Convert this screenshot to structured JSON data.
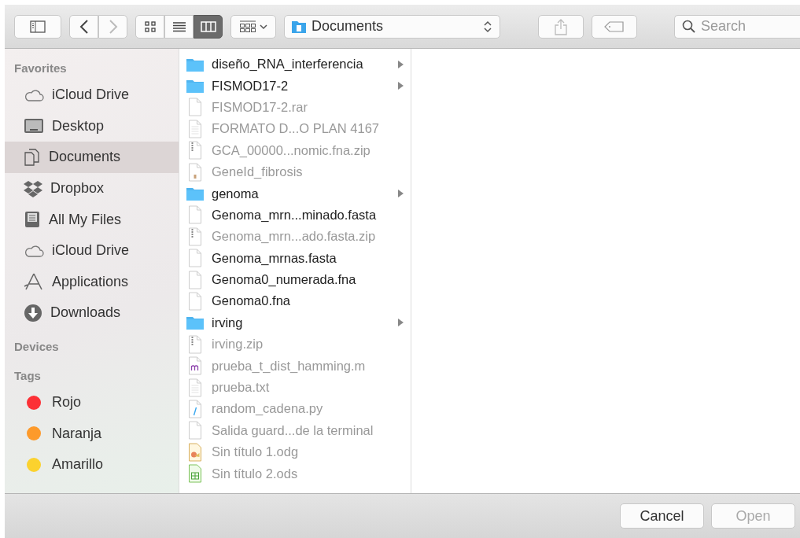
{
  "toolbar": {
    "views": [
      {
        "kind": "icon",
        "selected": false
      },
      {
        "kind": "list",
        "selected": false
      },
      {
        "kind": "column",
        "selected": true
      }
    ],
    "back_disabled": false,
    "forward_disabled": true,
    "share_disabled": true,
    "location": "Documents",
    "search": {
      "placeholder": "Search"
    }
  },
  "sidebar": {
    "sections": [
      {
        "title": "Favorites",
        "items": [
          {
            "label": "iCloud Drive",
            "kind": "cloud",
            "selected": false
          },
          {
            "label": "Desktop",
            "kind": "desktop",
            "selected": false
          },
          {
            "label": "Documents",
            "kind": "documents",
            "selected": true
          },
          {
            "label": "Dropbox",
            "kind": "dropbox",
            "selected": false
          },
          {
            "label": "All My Files",
            "kind": "allfiles",
            "selected": false
          },
          {
            "label": "iCloud Drive",
            "kind": "cloud",
            "selected": false
          },
          {
            "label": "Applications",
            "kind": "apps",
            "selected": false
          },
          {
            "label": "Downloads",
            "kind": "downloads",
            "selected": false
          }
        ]
      },
      {
        "title": "Devices"
      },
      {
        "title": "Tags",
        "items": [
          {
            "label": "Rojo",
            "kind": "tag",
            "color": "#fc3036",
            "selected": false
          },
          {
            "label": "Naranja",
            "kind": "tag",
            "color": "#fd9a2b",
            "selected": false
          },
          {
            "label": "Amarillo",
            "kind": "tag",
            "color": "#fbd22e",
            "selected": false
          }
        ]
      }
    ]
  },
  "column": {
    "items": [
      {
        "name": "diseño_RNA_interferencia",
        "kind": "folder",
        "disabled": false
      },
      {
        "name": "FISMOD17-2",
        "kind": "folder",
        "disabled": false
      },
      {
        "name": "FISMOD17-2.rar",
        "kind": "file",
        "disabled": true
      },
      {
        "name": "FORMATO D...O PLAN 4167",
        "kind": "text",
        "disabled": true
      },
      {
        "name": "GCA_00000...nomic.fna.zip",
        "kind": "zip",
        "disabled": true
      },
      {
        "name": "GeneId_fibrosis",
        "kind": "exec",
        "disabled": true
      },
      {
        "name": "genoma",
        "kind": "folder",
        "disabled": false
      },
      {
        "name": "Genoma_mrn...minado.fasta",
        "kind": "file",
        "disabled": false
      },
      {
        "name": "Genoma_mrn...ado.fasta.zip",
        "kind": "zip",
        "disabled": true
      },
      {
        "name": "Genoma_mrnas.fasta",
        "kind": "file",
        "disabled": false
      },
      {
        "name": "Genoma0_numerada.fna",
        "kind": "file",
        "disabled": false
      },
      {
        "name": "Genoma0.fna",
        "kind": "file",
        "disabled": false
      },
      {
        "name": "irving",
        "kind": "folder",
        "disabled": false
      },
      {
        "name": "irving.zip",
        "kind": "zip",
        "disabled": true
      },
      {
        "name": "prueba_t_dist_hamming.m",
        "kind": "matlab",
        "disabled": true
      },
      {
        "name": "prueba.txt",
        "kind": "text",
        "disabled": true
      },
      {
        "name": "random_cadena.py",
        "kind": "python",
        "disabled": true
      },
      {
        "name": "Salida guard...de la terminal",
        "kind": "file",
        "disabled": true
      },
      {
        "name": "Sin título 1.odg",
        "kind": "odg",
        "disabled": true
      },
      {
        "name": "Sin título 2.ods",
        "kind": "ods",
        "disabled": true
      }
    ]
  },
  "buttons": [
    {
      "label": "Cancel",
      "disabled": false
    },
    {
      "label": "Open",
      "disabled": true
    }
  ]
}
